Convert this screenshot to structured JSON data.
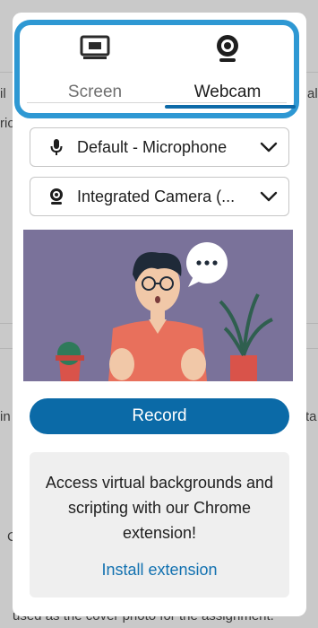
{
  "background": {
    "fragments": [
      "il",
      "rio",
      "al",
      "in",
      "ta",
      "C",
      "used as the cover photo for the assignment."
    ]
  },
  "tabs": [
    {
      "label": "Screen",
      "icon": "monitor-icon",
      "selected": false
    },
    {
      "label": "Webcam",
      "icon": "webcam-icon",
      "selected": true
    }
  ],
  "microphone_select": {
    "value": "Default - Microphone",
    "icon": "microphone-icon"
  },
  "camera_select": {
    "value": "Integrated Camera (...",
    "icon": "webcam-icon"
  },
  "record_button": {
    "label": "Record"
  },
  "promo": {
    "text": "Access virtual backgrounds and scripting with our Chrome extension!",
    "link_label": "Install extension"
  },
  "colors": {
    "accent": "#0b6aa7",
    "highlight_border": "#2e98d3",
    "preview_bg": "#7a729a",
    "link": "#1271b0"
  }
}
